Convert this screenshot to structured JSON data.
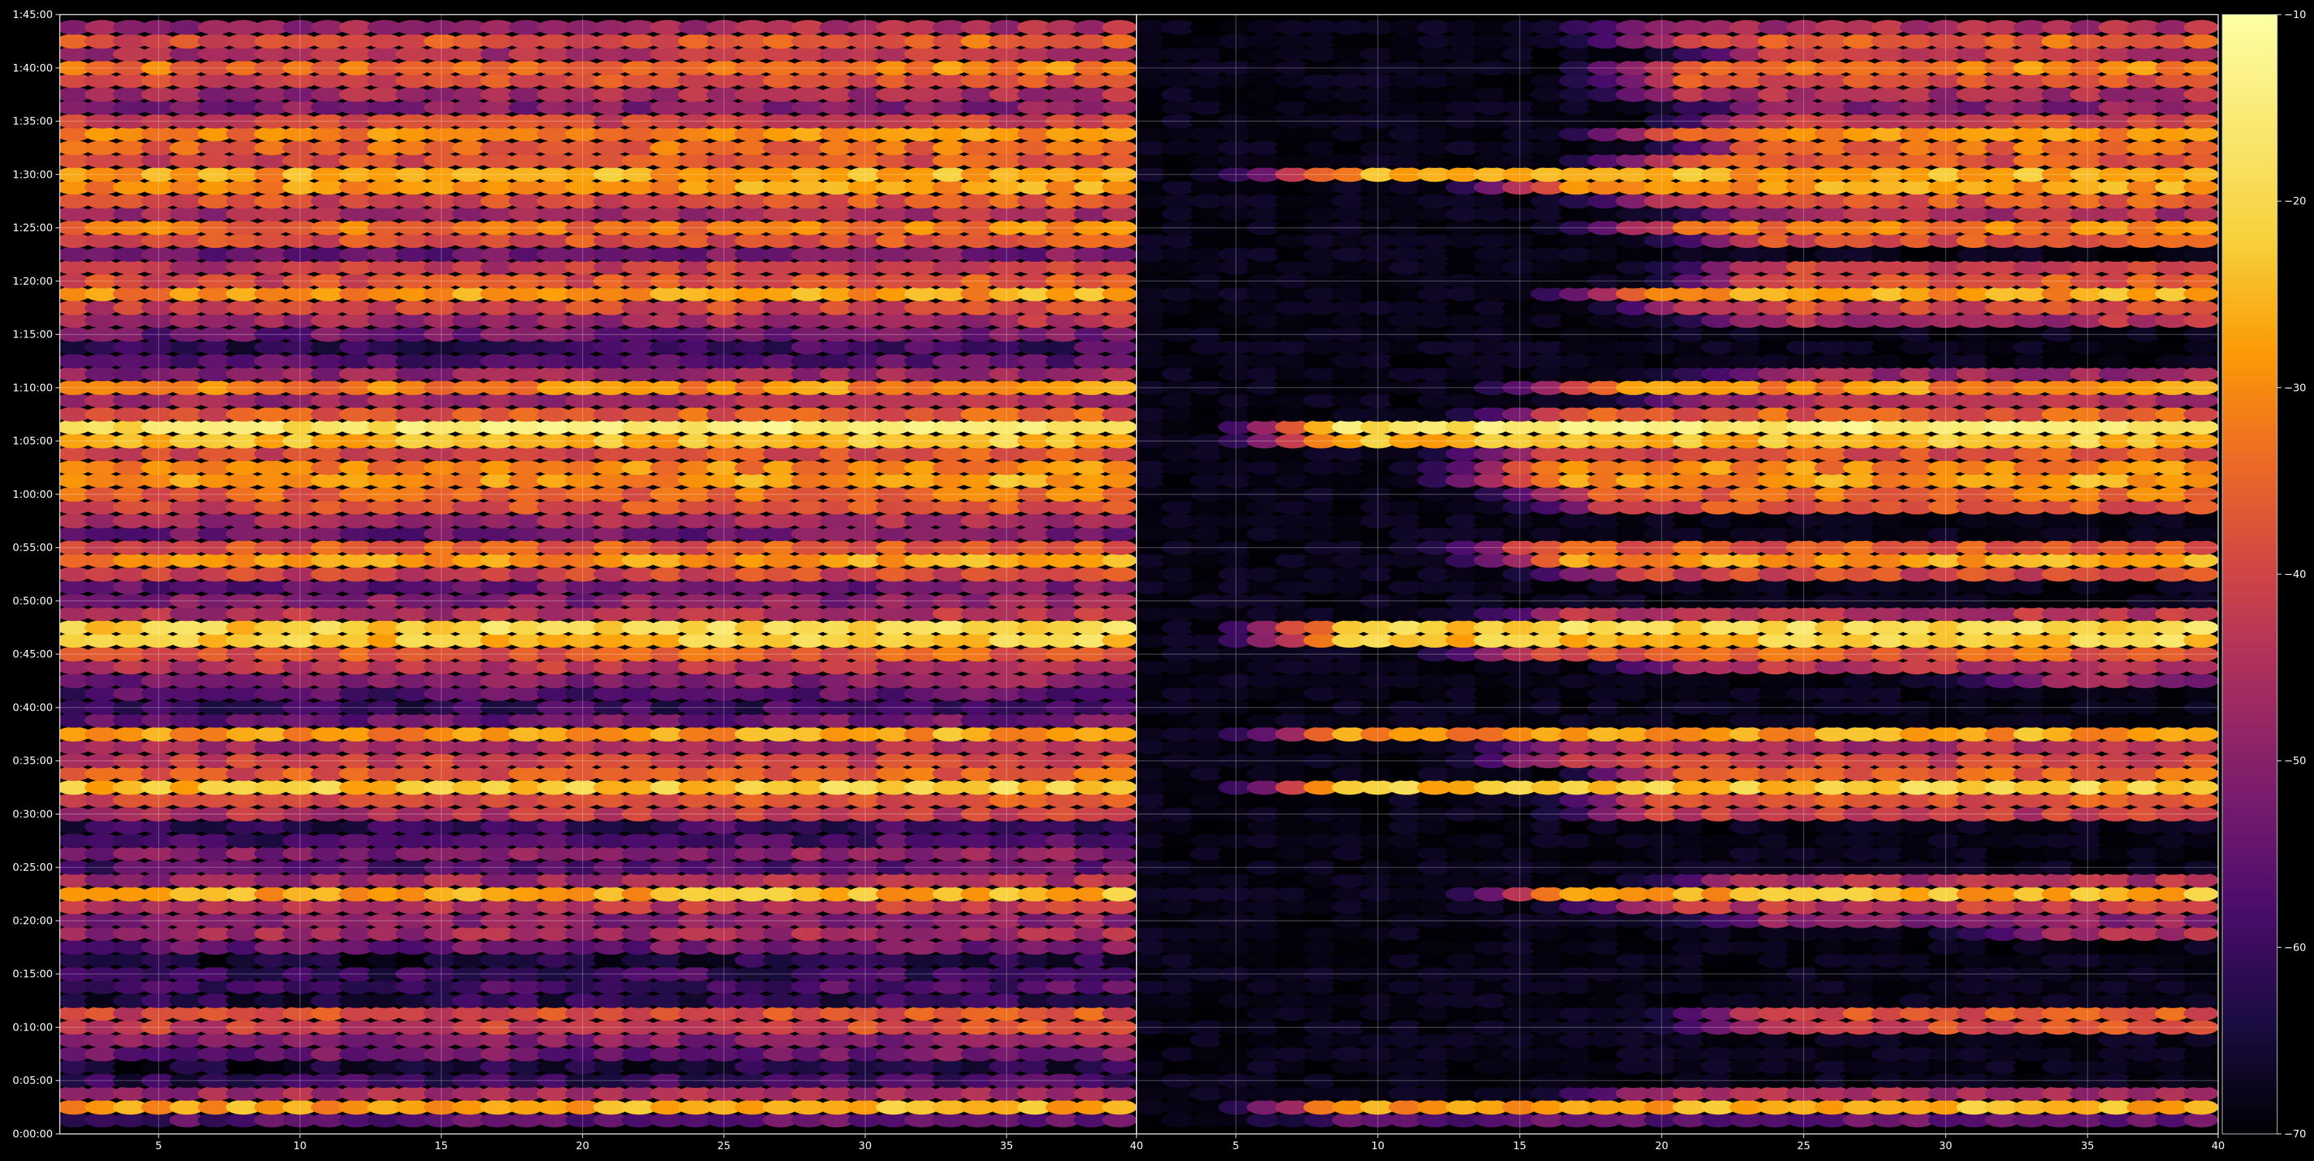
{
  "chart_data": [
    {
      "type": "heatmap",
      "title": "",
      "xlabel": "",
      "ylabel": "",
      "xlim": [
        1.5,
        39.6
      ],
      "ylim": [
        0,
        105
      ],
      "x_ticks": [
        5,
        10,
        15,
        20,
        25,
        30,
        35
      ],
      "x_tick_labels": [
        "5",
        "10",
        "15",
        "20",
        "25",
        "30",
        "35"
      ],
      "y_ticks": [
        0,
        5,
        10,
        15,
        20,
        25,
        30,
        35,
        40,
        45,
        50,
        55,
        60,
        65,
        70,
        75,
        80,
        85,
        90,
        95,
        100,
        105
      ],
      "y_tick_labels": [
        "0:00:00",
        "0:05:00",
        "0:10:00",
        "0:15:00",
        "0:20:00",
        "0:25:00",
        "0:30:00",
        "0:35:00",
        "0:40:00",
        "0:45:00",
        "0:50:00",
        "0:55:00",
        "1:00:00",
        "1:05:00",
        "1:10:00",
        "1:15:00",
        "1:20:00",
        "1:25:00",
        "1:30:00",
        "1:35:00",
        "1:40:00",
        "1:45:00"
      ],
      "grid": true,
      "x_step": 1,
      "y_step_minutes": 1.25,
      "value_unit_note": "",
      "cell_values": {
        "x_start": 2,
        "x_end": 39,
        "row_minutes": [
          1.3,
          2.5,
          3.8,
          5,
          6.3,
          7.5,
          8.8,
          10,
          11.3,
          12.5,
          13.8,
          15,
          16.3,
          17.5,
          18.8,
          20,
          21.3,
          22.5,
          23.8,
          25,
          26.3,
          27.5,
          28.8,
          30,
          31.3,
          32.5,
          33.8,
          35,
          36.3,
          37.5,
          38.8,
          40,
          41.3,
          42.5,
          43.8,
          45,
          46.3,
          47.5,
          48.8,
          50,
          51.3,
          52.5,
          53.8,
          55,
          56.3,
          57.5,
          58.8,
          60,
          61.3,
          62.5,
          63.8,
          65,
          66.3,
          67.5,
          68.8,
          70,
          71.3,
          72.5,
          73.8,
          75,
          76.3,
          77.5,
          78.8,
          80,
          81.3,
          82.5,
          83.8,
          85,
          86.3,
          87.5,
          88.8,
          90,
          91.3,
          92.5,
          93.8,
          95,
          96.3,
          97.5,
          98.8,
          100,
          101.3,
          102.5,
          103.8
        ],
        "row_level_db": [
          -58,
          -28,
          -48,
          -62,
          -66,
          -55,
          -52,
          -42,
          -40,
          -64,
          -60,
          -62,
          -66,
          -55,
          -48,
          -52,
          -45,
          -28,
          -48,
          -58,
          -52,
          -60,
          -62,
          -45,
          -40,
          -24,
          -38,
          -42,
          -48,
          -30,
          -55,
          -62,
          -58,
          -52,
          -45,
          -38,
          -24,
          -22,
          -46,
          -52,
          -55,
          -42,
          -30,
          -38,
          -55,
          -48,
          -40,
          -36,
          -30,
          -32,
          -40,
          -26,
          -18,
          -38,
          -48,
          -32,
          -50,
          -58,
          -62,
          -55,
          -48,
          -42,
          -30,
          -40,
          -44,
          -55,
          -40,
          -34,
          -48,
          -40,
          -30,
          -28,
          -40,
          -36,
          -32,
          -42,
          -52,
          -48,
          -40,
          -34,
          -46,
          -38,
          -48
        ],
        "row_level_db_right_panel_start_x": [
          5,
          5,
          16,
          40,
          40,
          40,
          40,
          20,
          20,
          40,
          40,
          40,
          40,
          40,
          30,
          20,
          16,
          13,
          19,
          40,
          40,
          40,
          40,
          16,
          16,
          5,
          17,
          13,
          13,
          5,
          40,
          40,
          40,
          30,
          18,
          12,
          5,
          5,
          13,
          40,
          40,
          15,
          13,
          12,
          40,
          40,
          15,
          14,
          12,
          12,
          12,
          5,
          5,
          13,
          18,
          14,
          20,
          40,
          40,
          40,
          20,
          18,
          16,
          20,
          20,
          40,
          20,
          17,
          20,
          17,
          13,
          5,
          17,
          20,
          17,
          20,
          20,
          17,
          17,
          17,
          20,
          17,
          16
        ]
      },
      "panels": [
        "left",
        "right"
      ]
    },
    {
      "type": "colorbar",
      "range": [
        -70,
        -10
      ],
      "ticks": [
        -10,
        -20,
        -30,
        -40,
        -50,
        -60,
        -70
      ],
      "tick_labels": [
        "−10",
        "−20",
        "−30",
        "−40",
        "−50",
        "−60",
        "−70"
      ],
      "colormap": "inferno"
    }
  ]
}
